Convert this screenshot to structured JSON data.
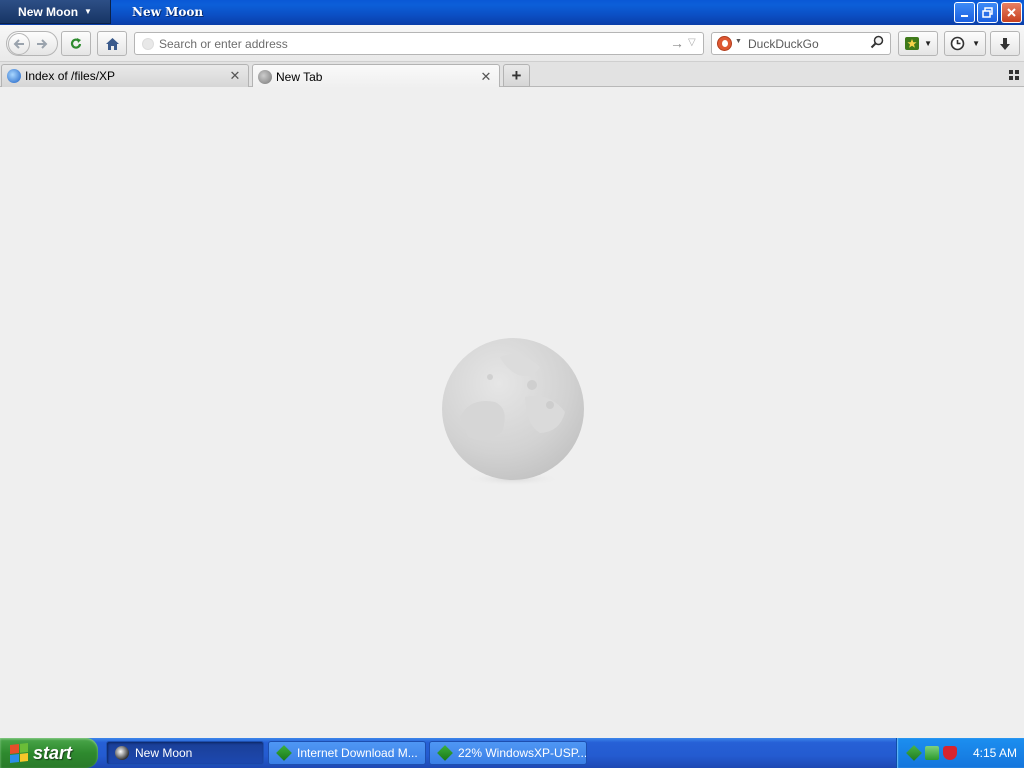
{
  "window": {
    "app_menu_label": "New Moon",
    "title": "New Moon"
  },
  "toolbar": {
    "url_placeholder": "Search or enter address",
    "search_engine": "DuckDuckGo",
    "search_placeholder": "DuckDuckGo"
  },
  "tabs": [
    {
      "label": "Index of /files/XP",
      "icon": "globe-icon",
      "selected": false
    },
    {
      "label": "New Tab",
      "icon": "globe-icon",
      "selected": true
    }
  ],
  "taskbar": {
    "start_label": "start",
    "tasks": [
      {
        "label": "New Moon",
        "active": true
      },
      {
        "label": "Internet Download M...",
        "active": false
      },
      {
        "label": "22% WindowsXP-USP...",
        "active": false
      }
    ],
    "clock": "4:15 AM"
  },
  "colors": {
    "titlebar": "#0b4fc4",
    "taskbar": "#245bd0",
    "start_button": "#2e8a2e",
    "content_background": "#efefef"
  }
}
